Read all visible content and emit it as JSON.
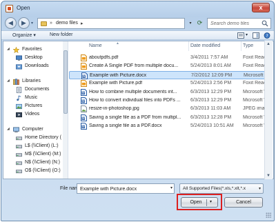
{
  "window": {
    "title": "Open",
    "close_glyph": "x"
  },
  "address": {
    "crumb": "demo files",
    "separator": "»",
    "arrow": "▸"
  },
  "search": {
    "placeholder": "Search demo files"
  },
  "toolbar": {
    "organize_label": "Organize ▾",
    "new_folder_label": "New folder"
  },
  "nav": {
    "items": [
      {
        "label": "Favorites",
        "icon": "star-icon",
        "level": 0
      },
      {
        "label": "Desktop",
        "icon": "desktop-icon",
        "level": 1
      },
      {
        "label": "Downloads",
        "icon": "downloads-icon",
        "level": 1
      },
      {
        "label": "Libraries",
        "icon": "libraries-icon",
        "level": 0
      },
      {
        "label": "Documents",
        "icon": "documents-icon",
        "level": 1
      },
      {
        "label": "Music",
        "icon": "music-icon",
        "level": 1
      },
      {
        "label": "Pictures",
        "icon": "pictures-icon",
        "level": 1
      },
      {
        "label": "Videos",
        "icon": "videos-icon",
        "level": 1
      },
      {
        "label": "Computer",
        "icon": "computer-icon",
        "level": 0
      },
      {
        "label": "Home Directory (",
        "icon": "drive-icon",
        "level": 1
      },
      {
        "label": "L$ (\\\\Client) (L:)",
        "icon": "drive-icon",
        "level": 1
      },
      {
        "label": "M$ (\\\\Client) (M:)",
        "icon": "drive-icon",
        "level": 1
      },
      {
        "label": "N$ (\\\\Client) (N:)",
        "icon": "drive-icon",
        "level": 1
      },
      {
        "label": "O$ (\\\\Client) (O:)",
        "icon": "drive-icon",
        "level": 1
      }
    ]
  },
  "columns": {
    "name": "Name",
    "date": "Date modified",
    "type": "Type"
  },
  "files": [
    {
      "name": "aboutpdfs.pdf",
      "date": "3/4/2011 7:57 AM",
      "type": "Foxit Reader",
      "icon": "pdf-icon",
      "selected": false
    },
    {
      "name": "Create A Single PDF from multiple docu...",
      "date": "5/24/2013 8:01 AM",
      "type": "Foxit Reader",
      "icon": "pdf-icon",
      "selected": false
    },
    {
      "name": "Example with Picture.docx",
      "date": "7/2/2012 12:09 PM",
      "type": "Microsoft W",
      "icon": "word-icon",
      "selected": true
    },
    {
      "name": "Example with Picture.pdf",
      "date": "5/24/2013 2:56 PM",
      "type": "Foxit Reader",
      "icon": "pdf-icon",
      "selected": false
    },
    {
      "name": "How to combine multiple documents int...",
      "date": "6/3/2013 12:29 PM",
      "type": "Microsoft W",
      "icon": "word-icon",
      "selected": false
    },
    {
      "name": "How to convert individual files into PDFs ...",
      "date": "6/3/2013 12:29 PM",
      "type": "Microsoft W",
      "icon": "word-icon",
      "selected": false
    },
    {
      "name": "resize-in-photoshop.jpg",
      "date": "6/3/2013 11:03 AM",
      "type": "JPEG image",
      "icon": "image-icon",
      "selected": false
    },
    {
      "name": "Saving a single file as a PDF from multipl...",
      "date": "6/3/2013 12:28 PM",
      "type": "Microsoft W",
      "icon": "word-icon",
      "selected": false
    },
    {
      "name": "Saving a single file as a PDF.docx",
      "date": "5/24/2013 10:51 AM",
      "type": "Microsoft W",
      "icon": "word-icon",
      "selected": false
    }
  ],
  "bottom": {
    "file_name_label": "File name:",
    "file_name_value": "Example with Picture.docx",
    "filter_value": "All Supported Files(*.xls,*.xlt,*.x",
    "open_label": "Open",
    "cancel_label": "Cancel"
  },
  "colors": {
    "highlight": "#dc1f1f",
    "selection": "#cde4fb",
    "window_frame": "#c6dbf1"
  }
}
